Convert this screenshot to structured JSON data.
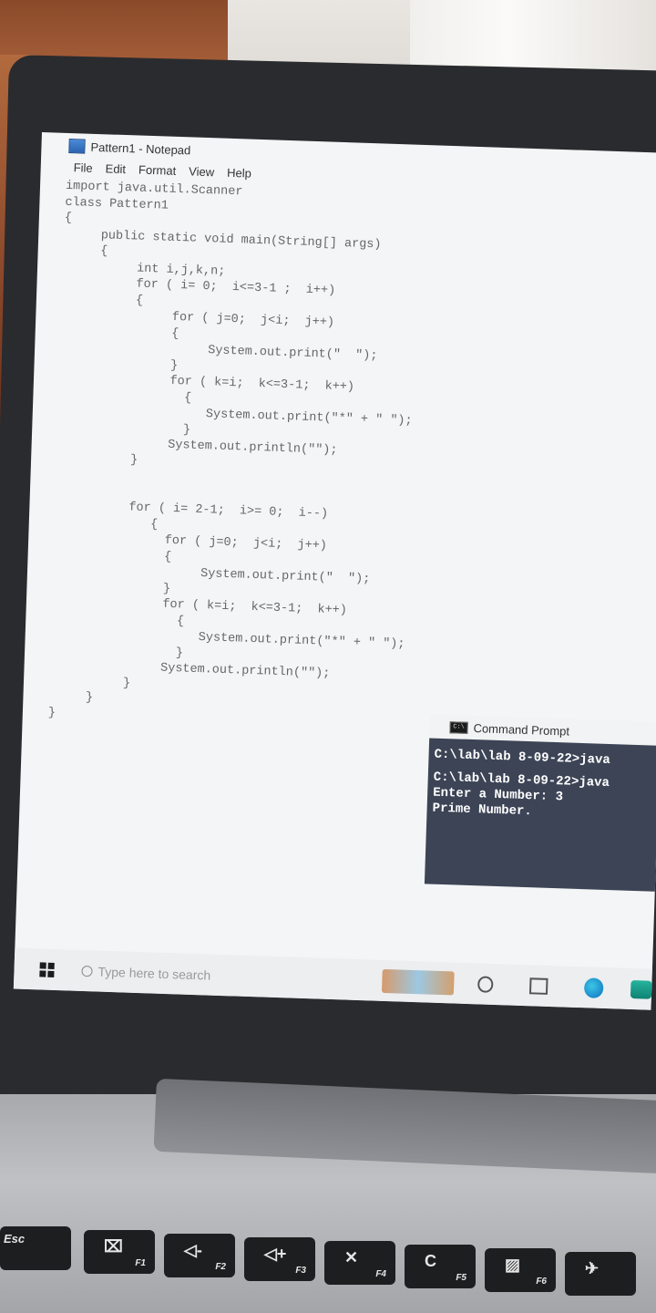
{
  "window": {
    "title": "Pattern1 - Notepad",
    "menu": [
      "File",
      "Edit",
      "Format",
      "View",
      "Help"
    ]
  },
  "code_lines": [
    "import java.util.Scanner",
    "class Pattern1",
    "{",
    "     public static void main(String[] args)",
    "     {",
    "          int i,j,k,n;",
    "          for ( i= 0;  i<=3-1 ;  i++)",
    "          {",
    "               for ( j=0;  j<i;  j++)",
    "               {",
    "                    System.out.print(\"  \");",
    "               }",
    "               for ( k=i;  k<=3-1;  k++)",
    "                 {",
    "                    System.out.print(\"*\" + \" \");",
    "                 }",
    "               System.out.println(\"\");",
    "          }",
    "",
    "",
    "          for ( i= 2-1;  i>= 0;  i--)",
    "             {",
    "               for ( j=0;  j<i;  j++)",
    "               {",
    "                    System.out.print(\"  \");",
    "               }",
    "               for ( k=i;  k<=3-1;  k++)",
    "                 {",
    "                    System.out.print(\"*\" + \" \");",
    "                 }",
    "               System.out.println(\"\");",
    "          }",
    "     }",
    "}"
  ],
  "command_prompt": {
    "title": "Command Prompt",
    "icon_text": "C:\\",
    "lines": [
      "C:\\lab\\lab 8-09-22>java",
      "",
      "C:\\lab\\lab 8-09-22>java",
      "Enter a Number: 3",
      "Prime Number."
    ]
  },
  "taskbar": {
    "search_placeholder": "Type here to search"
  },
  "keys": [
    {
      "label": "Esc",
      "sym": ""
    },
    {
      "label": "F1",
      "sym": "⌧"
    },
    {
      "label": "F2",
      "sym": "◁-"
    },
    {
      "label": "F3",
      "sym": "◁+"
    },
    {
      "label": "F4",
      "sym": "✕"
    },
    {
      "label": "F5",
      "sym": "C"
    },
    {
      "label": "F6",
      "sym": "▨"
    },
    {
      "label": "",
      "sym": "✈"
    }
  ]
}
